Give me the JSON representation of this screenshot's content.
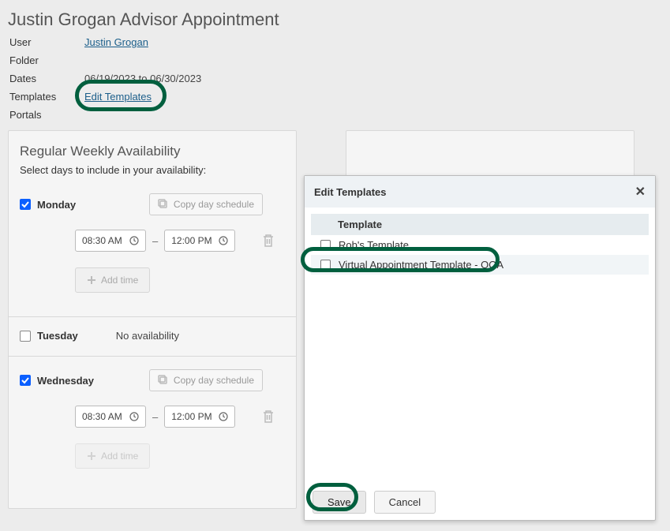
{
  "page": {
    "title": "Justin Grogan Advisor Appointment"
  },
  "meta": {
    "user_label": "User",
    "user_value": "Justin Grogan",
    "folder_label": "Folder",
    "folder_value": "",
    "dates_label": "Dates",
    "dates_value": "06/19/2023 to 06/30/2023",
    "templates_label": "Templates",
    "edit_templates_link": "Edit Templates",
    "portals_label": "Portals"
  },
  "availability": {
    "title": "Regular Weekly Availability",
    "subtitle": "Select days to include in your availability:",
    "copy_label": "Copy day schedule",
    "add_time_label": "Add time",
    "no_availability_label": "No availability",
    "days": [
      {
        "name": "Monday",
        "checked": true,
        "start": "08:30 AM",
        "end": "12:00 PM"
      },
      {
        "name": "Tuesday",
        "checked": false
      },
      {
        "name": "Wednesday",
        "checked": true,
        "start": "08:30 AM",
        "end": "12:00 PM"
      }
    ]
  },
  "modal": {
    "title": "Edit Templates",
    "header_template": "Template",
    "rows": [
      {
        "label": "Rob's Template"
      },
      {
        "label": "Virtual Appointment Template - OOA"
      }
    ],
    "save_label": "Save",
    "cancel_label": "Cancel"
  }
}
